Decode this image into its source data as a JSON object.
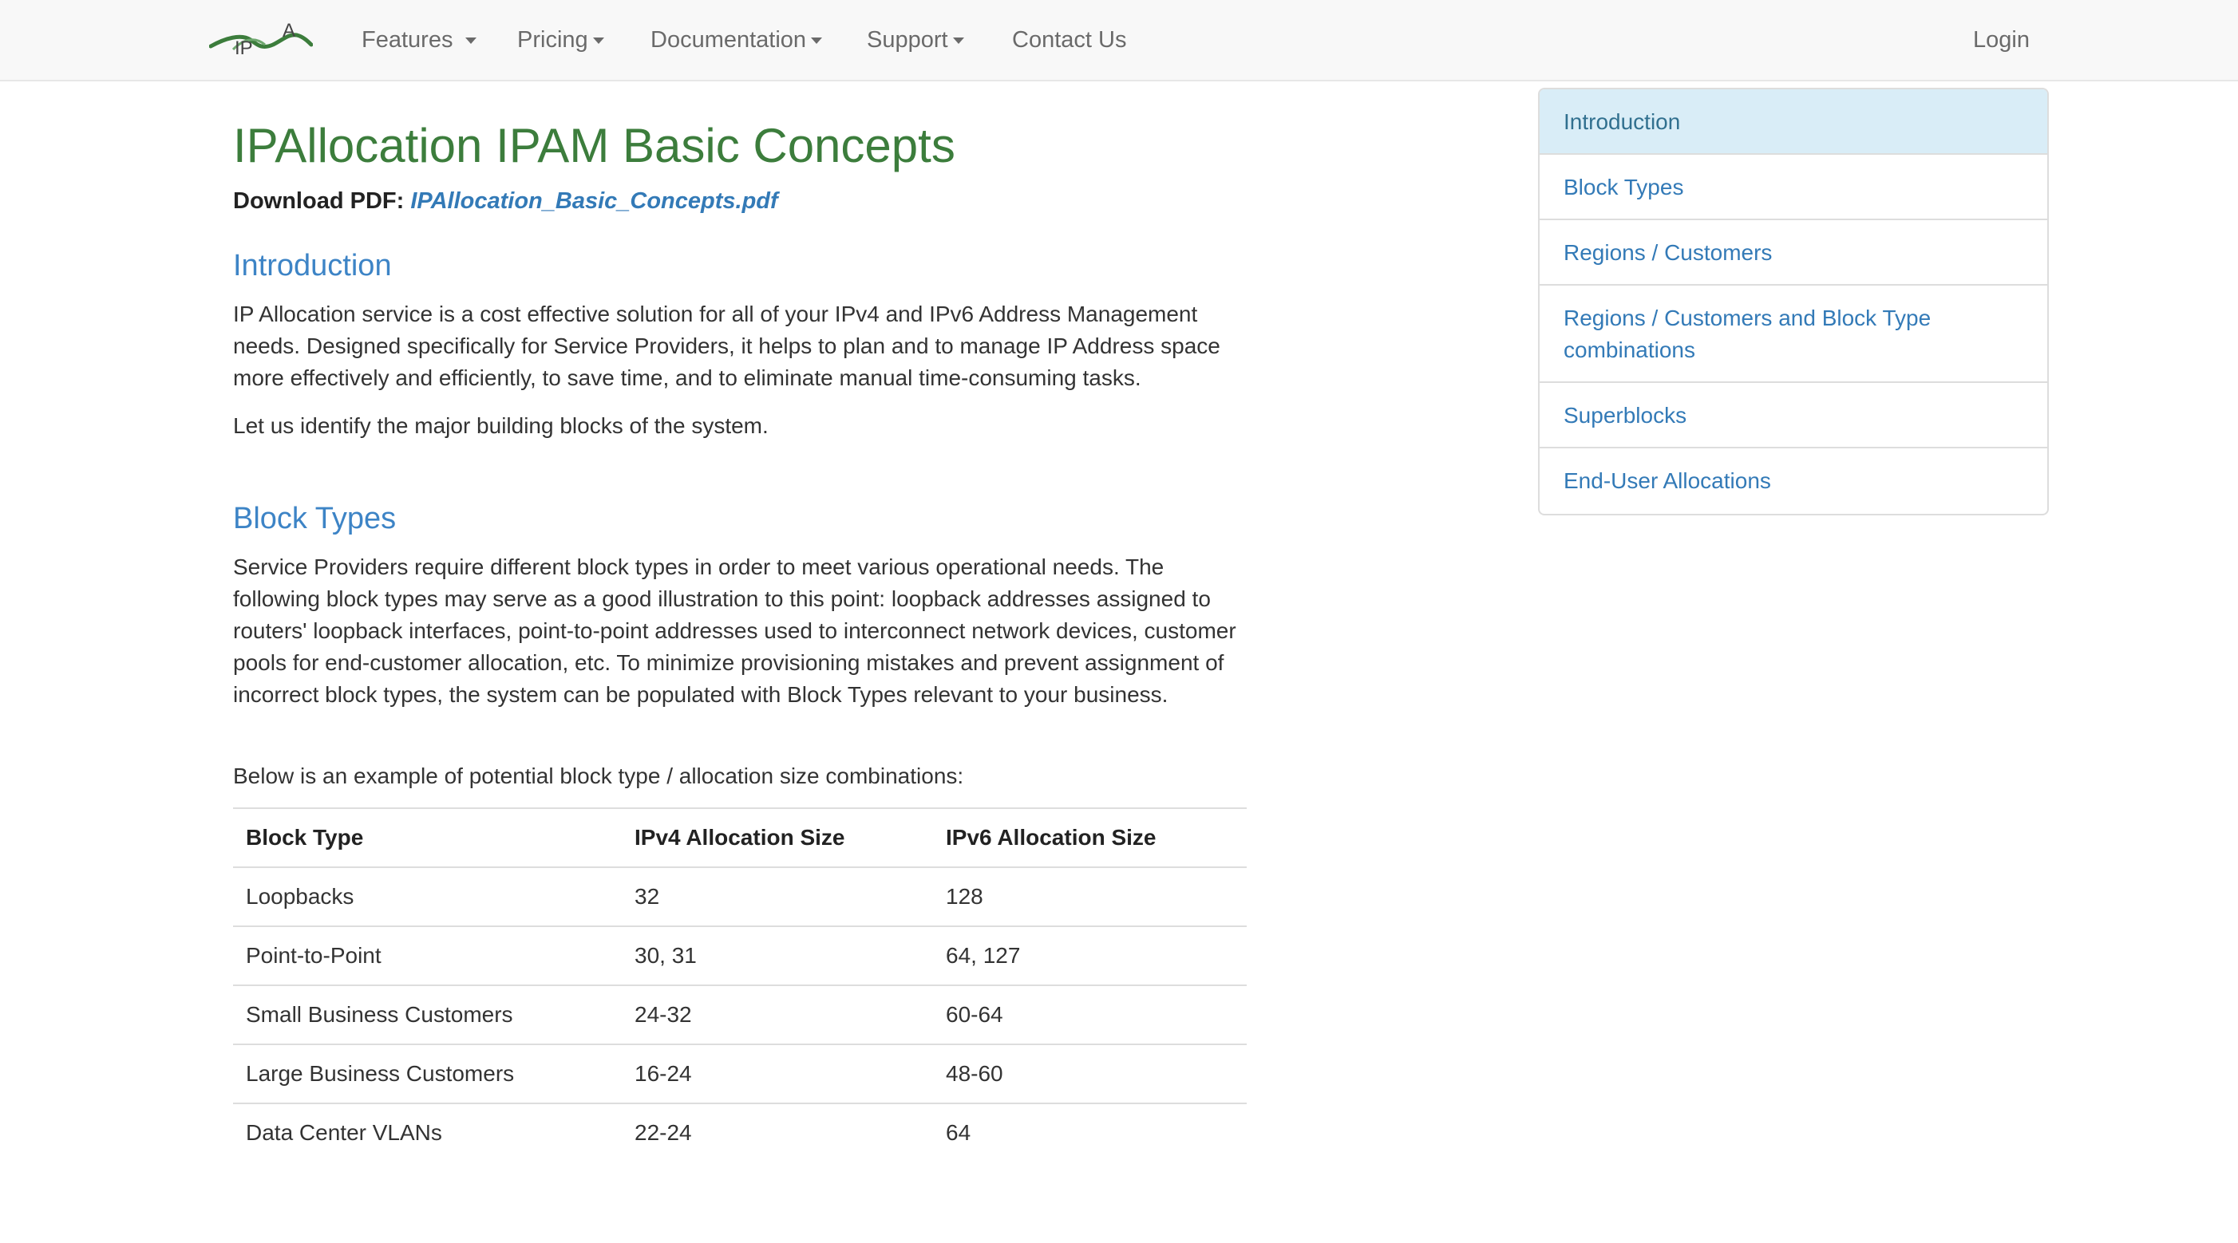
{
  "nav": {
    "logo_text": "IPA",
    "items": [
      {
        "label": "Features",
        "has_caret": true
      },
      {
        "label": "Pricing",
        "has_caret": true
      },
      {
        "label": "Documentation",
        "has_caret": true
      },
      {
        "label": "Support",
        "has_caret": true
      },
      {
        "label": "Contact Us",
        "has_caret": false
      }
    ],
    "login": "Login"
  },
  "main": {
    "title": "IPAllocation IPAM Basic Concepts",
    "download_label": "Download PDF:",
    "download_link": "IPAllocation_Basic_Concepts.pdf",
    "intro": {
      "heading": "Introduction",
      "paragraph": "IP Allocation service is a cost effective solution for all of your IPv4 and IPv6 Address Management needs. Designed specifically for Service Providers, it helps to plan and to manage IP Address space more effectively and efficiently, to save time, and to eliminate manual time-consuming tasks.",
      "paragraph2": "Let us identify the major building blocks of the system."
    },
    "block_types": {
      "heading": "Block Types",
      "paragraph": "Service Providers require different block types in order to meet various operational needs. The following block types may serve as a good illustration to this point: loopback addresses assigned to routers' loopback interfaces, point-to-point addresses used to interconnect network devices, customer pools for end-customer allocation, etc. To minimize provisioning mistakes and prevent assignment of incorrect block types, the system can be populated with Block Types relevant to your business.",
      "paragraph2": "Below is an example of potential block type / allocation size combinations:"
    },
    "table": {
      "headers": [
        "Block Type",
        "IPv4 Allocation Size",
        "IPv6 Allocation Size"
      ],
      "rows": [
        [
          "Loopbacks",
          "32",
          "128"
        ],
        [
          "Point-to-Point",
          "30, 31",
          "64, 127"
        ],
        [
          "Small Business Customers",
          "24-32",
          "60-64"
        ],
        [
          "Large Business Customers",
          "16-24",
          "48-60"
        ],
        [
          "Data Center VLANs",
          "22-24",
          "64"
        ]
      ]
    }
  },
  "sidebar": {
    "items": [
      {
        "label": "Introduction",
        "active": true
      },
      {
        "label": "Block Types",
        "active": false
      },
      {
        "label": "Regions / Customers",
        "active": false
      },
      {
        "label": "Regions / Customers and Block Type combinations",
        "active": false
      },
      {
        "label": "Superblocks",
        "active": false
      },
      {
        "label": "End-User Allocations",
        "active": false
      }
    ]
  },
  "colors": {
    "title_green": "#3c7d3c",
    "heading_blue": "#3d84c6",
    "link_blue": "#337ab7",
    "active_bg": "#d9edf7"
  }
}
